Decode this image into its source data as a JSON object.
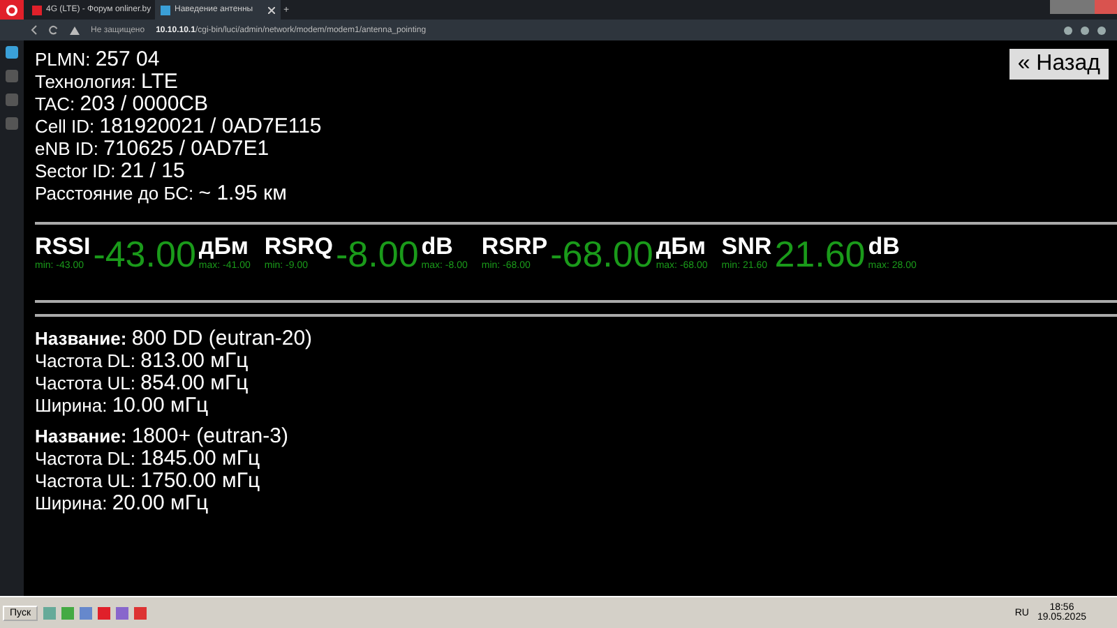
{
  "browser": {
    "tabs": [
      {
        "title": "4G (LTE) - Форум onliner.by",
        "selected": false
      },
      {
        "title": "Наведение антенны",
        "selected": true
      }
    ],
    "new_tab": "+",
    "security": "Не защищено",
    "url_host": "10.10.10.1",
    "url_path": "/cgi-bin/luci/admin/network/modem/modem1/antenna_pointing"
  },
  "info": [
    {
      "label": "PLMN: ",
      "value": "257 04"
    },
    {
      "label": "Технология: ",
      "value": "LTE"
    },
    {
      "label": "TAC: ",
      "value": "203 / 0000CB"
    },
    {
      "label": "Cell ID: ",
      "value": "181920021 / 0AD7E115"
    },
    {
      "label": "eNB ID: ",
      "value": "710625 / 0AD7E1"
    },
    {
      "label": "Sector ID: ",
      "value": "21 / 15"
    },
    {
      "label": "Расстояние до БС: ",
      "value": "~ 1.95 км"
    }
  ],
  "back_button": "« Назад",
  "metrics": [
    {
      "name": "RSSI",
      "value": "-43.00",
      "unit": "дБм",
      "min": "min: -43.00",
      "max": "max: -41.00"
    },
    {
      "name": "RSRQ",
      "value": "-8.00",
      "unit": "dB",
      "min": "min: -9.00",
      "max": "max: -8.00"
    },
    {
      "name": "RSRP",
      "value": "-68.00",
      "unit": "дБм",
      "min": "min: -68.00",
      "max": "max: -68.00"
    },
    {
      "name": "SNR",
      "value": "21.60",
      "unit": "dB",
      "min": "min: 21.60",
      "max": "max: 28.00"
    }
  ],
  "bands": [
    {
      "name_label": "Название:",
      "name": "800 DD (eutran-20)",
      "lines": [
        {
          "label": "Частота DL: ",
          "value": "813.00 мГц"
        },
        {
          "label": "Частота UL: ",
          "value": "854.00 мГц"
        },
        {
          "label": "Ширина: ",
          "value": "10.00 мГц"
        }
      ]
    },
    {
      "name_label": "Название:",
      "name": "1800+ (eutran-3)",
      "lines": [
        {
          "label": "Частота DL: ",
          "value": "1845.00 мГц"
        },
        {
          "label": "Частота UL: ",
          "value": "1750.00 мГц"
        },
        {
          "label": "Ширина: ",
          "value": "20.00 мГц"
        }
      ]
    }
  ],
  "taskbar": {
    "start": "Пуск",
    "lang": "RU",
    "time": "18:56",
    "date": "19.05.2025"
  }
}
